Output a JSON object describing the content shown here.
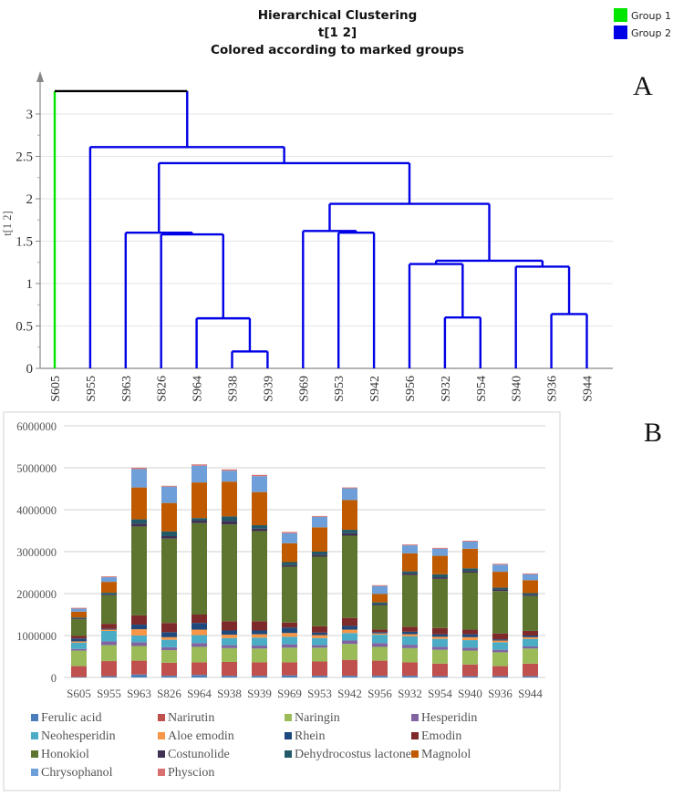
{
  "chart_data": [
    {
      "type": "dendrogram",
      "panel_label": "A",
      "title": [
        "Hierarchical Clustering",
        "t[1 2]",
        "Colored according to marked groups"
      ],
      "ylabel": "t[1 2]",
      "ylim": [
        0,
        3.3
      ],
      "yticks": [
        0,
        0.5,
        1,
        1.5,
        2,
        2.5,
        3
      ],
      "grid": true,
      "legend": {
        "placement": "top-right",
        "entries": [
          {
            "name": "Group 1",
            "color": "#00e600"
          },
          {
            "name": "Group 2",
            "color": "#0000e6"
          }
        ]
      },
      "root_color": "#000000",
      "leaves": [
        {
          "label": "S605",
          "group": "Group 1"
        },
        {
          "label": "S955",
          "group": "Group 2"
        },
        {
          "label": "S963",
          "group": "Group 2"
        },
        {
          "label": "S826",
          "group": "Group 2"
        },
        {
          "label": "S964",
          "group": "Group 2"
        },
        {
          "label": "S938",
          "group": "Group 2"
        },
        {
          "label": "S939",
          "group": "Group 2"
        },
        {
          "label": "S969",
          "group": "Group 2"
        },
        {
          "label": "S953",
          "group": "Group 2"
        },
        {
          "label": "S942",
          "group": "Group 2"
        },
        {
          "label": "S956",
          "group": "Group 2"
        },
        {
          "label": "S932",
          "group": "Group 2"
        },
        {
          "label": "S954",
          "group": "Group 2"
        },
        {
          "label": "S940",
          "group": "Group 2"
        },
        {
          "label": "S936",
          "group": "Group 2"
        },
        {
          "label": "S944",
          "group": "Group 2"
        }
      ],
      "merges": [
        {
          "id": "m1",
          "left": "S938",
          "right": "S939",
          "height": 0.2
        },
        {
          "id": "m2",
          "left": "S964",
          "right": "m1",
          "height": 0.59
        },
        {
          "id": "m3",
          "left": "S826",
          "right": "m2",
          "height": 1.58
        },
        {
          "id": "m4",
          "left": "S963",
          "right": "m3",
          "height": 1.6
        },
        {
          "id": "m5",
          "left": "S953",
          "right": "S942",
          "height": 1.6
        },
        {
          "id": "m6",
          "left": "S969",
          "right": "m5",
          "height": 1.62
        },
        {
          "id": "m7",
          "left": "S932",
          "right": "S954",
          "height": 0.6
        },
        {
          "id": "m8",
          "left": "S956",
          "right": "m7",
          "height": 1.23
        },
        {
          "id": "m9",
          "left": "S936",
          "right": "S944",
          "height": 0.64
        },
        {
          "id": "m10",
          "left": "S940",
          "right": "m9",
          "height": 1.2
        },
        {
          "id": "m11",
          "left": "m8",
          "right": "m10",
          "height": 1.27
        },
        {
          "id": "m12",
          "left": "m6",
          "right": "m11",
          "height": 1.94
        },
        {
          "id": "m13",
          "left": "m4",
          "right": "m12",
          "height": 2.42
        },
        {
          "id": "m14",
          "left": "S955",
          "right": "m13",
          "height": 2.61
        },
        {
          "id": "m15",
          "left": "S605",
          "right": "m14",
          "height": 3.27
        }
      ]
    },
    {
      "type": "bar",
      "stacked": true,
      "panel_label": "B",
      "title": "",
      "xlabel": "",
      "ylabel": "",
      "ylim": [
        0,
        6000000
      ],
      "yticks": [
        0,
        1000000,
        2000000,
        3000000,
        4000000,
        5000000,
        6000000
      ],
      "grid": true,
      "legend": {
        "placement": "bottom"
      },
      "categories": [
        "S605",
        "S955",
        "S963",
        "S826",
        "S964",
        "S938",
        "S939",
        "S969",
        "S953",
        "S942",
        "S956",
        "S932",
        "S954",
        "S940",
        "S936",
        "S944"
      ],
      "series": [
        {
          "name": "Ferulic acid",
          "color": "#4a7ebb",
          "values": [
            10000,
            30000,
            70000,
            40000,
            60000,
            40000,
            40000,
            50000,
            40000,
            40000,
            40000,
            40000,
            30000,
            30000,
            30000,
            30000
          ]
        },
        {
          "name": "Narirutin",
          "color": "#c0504d",
          "values": [
            260000,
            360000,
            330000,
            310000,
            300000,
            330000,
            320000,
            310000,
            340000,
            380000,
            360000,
            320000,
            300000,
            280000,
            240000,
            300000
          ]
        },
        {
          "name": "Naringin",
          "color": "#9bbb59",
          "values": [
            370000,
            380000,
            350000,
            300000,
            370000,
            330000,
            330000,
            350000,
            330000,
            380000,
            330000,
            340000,
            330000,
            330000,
            330000,
            360000
          ]
        },
        {
          "name": "Hesperidin",
          "color": "#8064a2",
          "values": [
            40000,
            90000,
            90000,
            70000,
            90000,
            70000,
            70000,
            80000,
            60000,
            80000,
            90000,
            80000,
            70000,
            70000,
            60000,
            50000
          ]
        },
        {
          "name": "Neohesperidin",
          "color": "#4bacc6",
          "values": [
            150000,
            250000,
            160000,
            180000,
            190000,
            170000,
            190000,
            180000,
            170000,
            180000,
            200000,
            200000,
            190000,
            180000,
            180000,
            180000
          ]
        },
        {
          "name": "Aloe emodin",
          "color": "#f79646",
          "values": [
            30000,
            30000,
            150000,
            60000,
            130000,
            80000,
            80000,
            90000,
            70000,
            80000,
            30000,
            50000,
            50000,
            70000,
            40000,
            40000
          ]
        },
        {
          "name": "Rhein",
          "color": "#1f497d",
          "values": [
            70000,
            20000,
            110000,
            120000,
            160000,
            100000,
            90000,
            130000,
            60000,
            90000,
            30000,
            60000,
            60000,
            70000,
            30000,
            40000
          ]
        },
        {
          "name": "Emodin",
          "color": "#7f2a2a",
          "values": [
            60000,
            120000,
            220000,
            220000,
            200000,
            220000,
            220000,
            120000,
            150000,
            190000,
            60000,
            120000,
            150000,
            110000,
            140000,
            110000
          ]
        },
        {
          "name": "Honokiol",
          "color": "#5e7530",
          "values": [
            400000,
            680000,
            2120000,
            2010000,
            2180000,
            2310000,
            2150000,
            1330000,
            1660000,
            1960000,
            580000,
            1230000,
            1170000,
            1360000,
            1010000,
            830000
          ]
        },
        {
          "name": "Costunolide",
          "color": "#403152",
          "values": [
            20000,
            20000,
            70000,
            60000,
            60000,
            80000,
            60000,
            40000,
            50000,
            60000,
            20000,
            40000,
            40000,
            40000,
            40000,
            30000
          ]
        },
        {
          "name": "Dehydrocostus lactone",
          "color": "#215968",
          "values": [
            20000,
            40000,
            100000,
            110000,
            60000,
            110000,
            80000,
            70000,
            70000,
            80000,
            50000,
            50000,
            70000,
            60000,
            40000,
            40000
          ]
        },
        {
          "name": "Magnolol",
          "color": "#c05a00",
          "values": [
            140000,
            260000,
            760000,
            680000,
            850000,
            830000,
            790000,
            450000,
            580000,
            710000,
            200000,
            430000,
            440000,
            470000,
            380000,
            310000
          ]
        },
        {
          "name": "Chrysophanol",
          "color": "#6f9fd8",
          "values": [
            70000,
            110000,
            440000,
            390000,
            400000,
            260000,
            380000,
            240000,
            250000,
            280000,
            190000,
            190000,
            170000,
            170000,
            170000,
            140000
          ]
        },
        {
          "name": "Physcion",
          "color": "#d97070",
          "values": [
            20000,
            20000,
            30000,
            20000,
            30000,
            30000,
            30000,
            30000,
            20000,
            20000,
            20000,
            20000,
            20000,
            20000,
            20000,
            20000
          ]
        }
      ]
    }
  ]
}
